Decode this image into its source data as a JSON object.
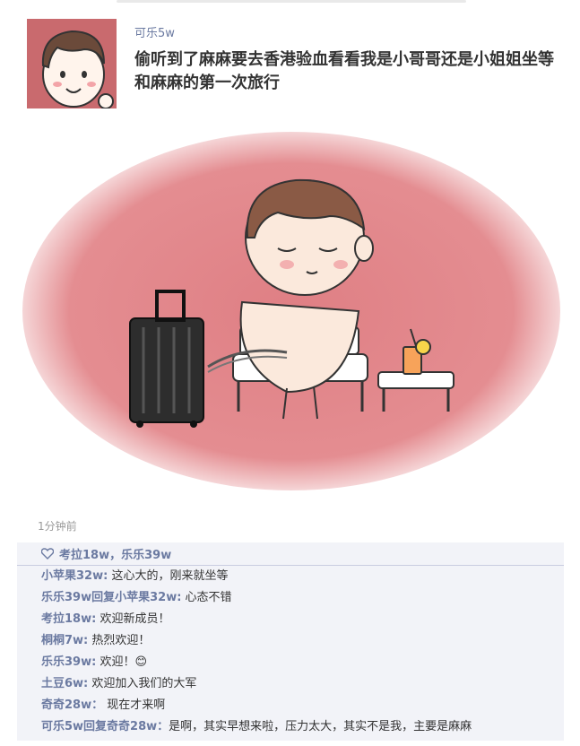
{
  "post": {
    "author": "可乐5w",
    "text": "偷听到了麻麻要去香港验血看看我是小哥哥还是小姐姐坐等和麻麻的第一次旅行",
    "time": "1分钟前"
  },
  "likes": {
    "icon": "heart-icon",
    "text": "考拉18w，乐乐39w"
  },
  "comments": [
    {
      "author": "小苹果32w:",
      "text": " 这心大的，刚来就坐等"
    },
    {
      "author": "乐乐39w回复小苹果32w:",
      "text": " 心态不错"
    },
    {
      "author": "考拉18w:",
      "text": " 欢迎新成员！"
    },
    {
      "author": "桐桐7w:",
      "text": " 热烈欢迎！"
    },
    {
      "author": "乐乐39w:",
      "text": " 欢迎！😊"
    },
    {
      "author": "土豆6w:",
      "text": " 欢迎加入我们的大军"
    },
    {
      "author": "奇奇28w：",
      "text": " 现在才来啊"
    },
    {
      "author": "可乐5w回复奇奇28w：",
      "text": "是啊，其实早想来啦，压力太大，其实不是我，主要是麻麻"
    }
  ],
  "colors": {
    "link": "#6b7aa1",
    "comments_bg": "#f2f3f8",
    "photo_bg": "#e0888c"
  }
}
